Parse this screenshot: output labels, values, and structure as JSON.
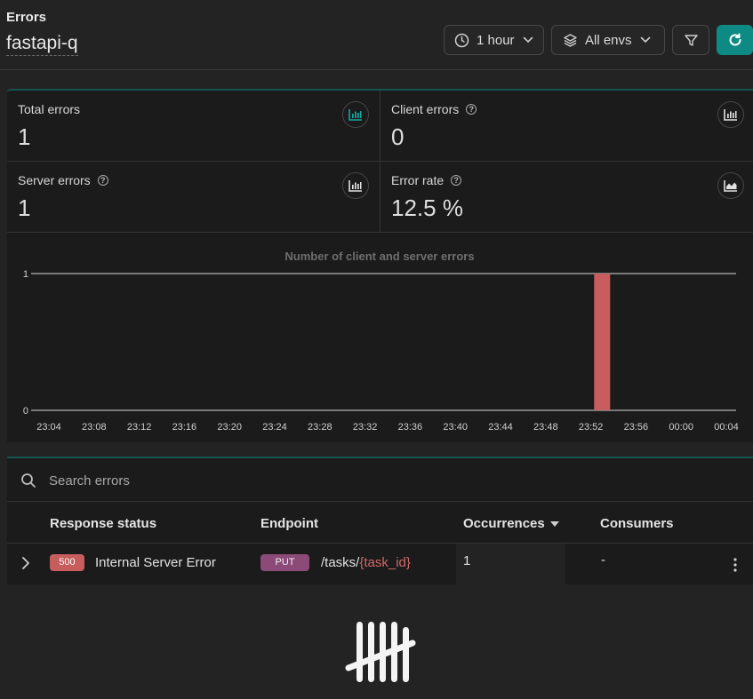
{
  "header": {
    "title": "Errors",
    "app_name": "fastapi-q",
    "time_range": "1 hour",
    "env": "All envs"
  },
  "stats": [
    {
      "label": "Total errors",
      "value": "1"
    },
    {
      "label": "Client errors",
      "value": "0"
    },
    {
      "label": "Server errors",
      "value": "1"
    },
    {
      "label": "Error rate",
      "value": "12.5 %"
    }
  ],
  "chart_data": {
    "type": "bar",
    "title": "Number of client and server errors",
    "x": [
      "23:04",
      "23:08",
      "23:12",
      "23:16",
      "23:20",
      "23:24",
      "23:28",
      "23:32",
      "23:36",
      "23:40",
      "23:44",
      "23:48",
      "23:52",
      "23:56",
      "00:00",
      "00:04"
    ],
    "bars": [
      {
        "x": "23:53",
        "value": 1
      }
    ],
    "ylim": [
      0,
      1
    ],
    "yticks": [
      "0",
      "1"
    ],
    "bar_color": "#c75d5d"
  },
  "search": {
    "placeholder": "Search errors"
  },
  "table": {
    "columns": [
      "Response status",
      "Endpoint",
      "Occurrences",
      "Consumers"
    ],
    "rows": [
      {
        "status_code": "500",
        "status_text": "Internal Server Error",
        "method": "PUT",
        "path_prefix": "/tasks/",
        "path_param": "{task_id}",
        "occurrences": "1",
        "consumers": "-"
      }
    ]
  },
  "colors": {
    "accent": "#0e8a84",
    "error": "#c75d5d",
    "method_put": "#8b4a78"
  }
}
